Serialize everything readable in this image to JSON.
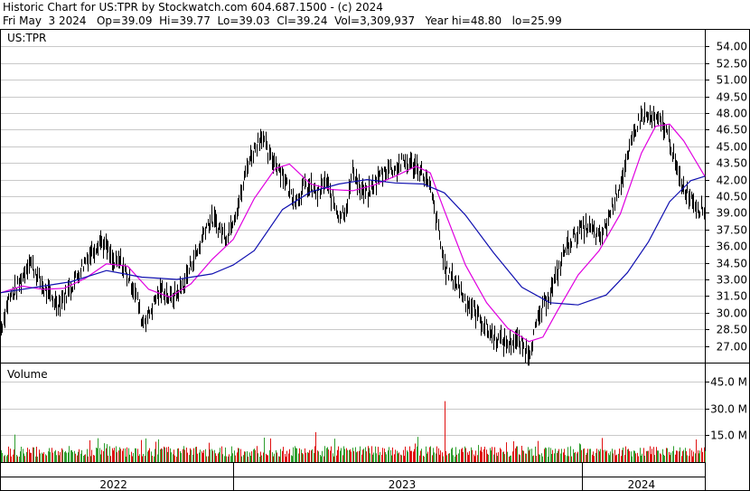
{
  "header": {
    "line1": "Historic Chart for US:TPR by Stockwatch.com 604.687.1500 - (c) 2024",
    "line2": "Fri May  3 2024   Op=39.09  Hi=39.77  Lo=39.03  Cl=39.24  Vol=3,309,937   Year hi=48.80   lo=25.99"
  },
  "colors": {
    "price": "#000000",
    "ma_short": "#e000e0",
    "ma_long": "#1010b0",
    "vol_up": "#2e9e2e",
    "vol_down": "#e01010",
    "frame": "#000000"
  },
  "chart_data": [
    {
      "type": "line",
      "label": "US:TPR",
      "y_axis": {
        "min": 25.5,
        "max": 55.5,
        "ticks": [
          54.0,
          52.5,
          51.0,
          49.5,
          48.0,
          46.5,
          45.0,
          43.5,
          42.0,
          40.5,
          39.0,
          37.5,
          36.0,
          34.5,
          33.0,
          31.5,
          30.0,
          28.5,
          27.0
        ],
        "tick_labels": [
          "54.00",
          "52.50",
          "51.00",
          "49.50",
          "48.00",
          "46.50",
          "45.00",
          "43.50",
          "42.00",
          "40.50",
          "39.00",
          "37.50",
          "36.00",
          "34.50",
          "33.00",
          "31.50",
          "30.00",
          "28.50",
          "27.00"
        ]
      },
      "x_range": [
        0,
        100
      ],
      "price_points": [
        [
          0,
          28.6
        ],
        [
          1,
          31.2
        ],
        [
          2,
          32.0
        ],
        [
          3,
          33.2
        ],
        [
          4,
          34.8
        ],
        [
          5,
          33.5
        ],
        [
          6,
          32.2
        ],
        [
          7,
          31.4
        ],
        [
          8,
          30.8
        ],
        [
          9,
          31.5
        ],
        [
          10,
          32.4
        ],
        [
          11,
          33.6
        ],
        [
          12,
          34.8
        ],
        [
          13,
          35.6
        ],
        [
          14,
          36.6
        ],
        [
          15,
          35.8
        ],
        [
          16,
          34.3
        ],
        [
          17,
          34.6
        ],
        [
          18,
          33.2
        ],
        [
          19,
          32.0
        ],
        [
          20,
          29.2
        ],
        [
          21,
          29.8
        ],
        [
          22,
          31.4
        ],
        [
          23,
          32.1
        ],
        [
          24,
          31.2
        ],
        [
          25,
          31.8
        ],
        [
          26,
          32.6
        ],
        [
          27,
          34.5
        ],
        [
          28,
          35.6
        ],
        [
          29,
          37.8
        ],
        [
          30,
          38.4
        ],
        [
          31,
          37.6
        ],
        [
          32,
          36.9
        ],
        [
          33,
          38.6
        ],
        [
          34,
          40.4
        ],
        [
          35,
          43.5
        ],
        [
          36,
          44.8
        ],
        [
          37,
          46.2
        ],
        [
          38,
          44.0
        ],
        [
          39,
          43.6
        ],
        [
          40,
          42.5
        ],
        [
          41,
          40.8
        ],
        [
          42,
          40.2
        ],
        [
          43,
          41.4
        ],
        [
          44,
          41.2
        ],
        [
          45,
          40.6
        ],
        [
          46,
          41.9
        ],
        [
          47,
          40.3
        ],
        [
          48,
          38.8
        ],
        [
          49,
          39.4
        ],
        [
          50,
          43.0
        ],
        [
          51,
          41.0
        ],
        [
          52,
          40.6
        ],
        [
          53,
          41.6
        ],
        [
          54,
          42.5
        ],
        [
          55,
          43.1
        ],
        [
          56,
          42.9
        ],
        [
          57,
          43.6
        ],
        [
          58,
          43.4
        ],
        [
          59,
          43.2
        ],
        [
          60,
          42.4
        ],
        [
          61,
          41.0
        ],
        [
          62,
          37.8
        ],
        [
          63,
          34.0
        ],
        [
          64,
          33.2
        ],
        [
          65,
          32.4
        ],
        [
          66,
          31.0
        ],
        [
          67,
          30.4
        ],
        [
          68,
          29.4
        ],
        [
          69,
          28.5
        ],
        [
          70,
          27.8
        ],
        [
          71,
          27.5
        ],
        [
          72,
          27.2
        ],
        [
          73,
          27.6
        ],
        [
          74,
          27.0
        ],
        [
          75,
          26.4
        ],
        [
          76,
          28.8
        ],
        [
          77,
          30.5
        ],
        [
          78,
          31.9
        ],
        [
          79,
          33.5
        ],
        [
          80,
          35.6
        ],
        [
          81,
          36.6
        ],
        [
          82,
          37.3
        ],
        [
          83,
          37.7
        ],
        [
          84,
          37.4
        ],
        [
          85,
          36.6
        ],
        [
          86,
          38.0
        ],
        [
          87,
          40.0
        ],
        [
          88,
          41.8
        ],
        [
          89,
          43.8
        ],
        [
          90,
          46.5
        ],
        [
          91,
          47.8
        ],
        [
          92,
          47.6
        ],
        [
          93,
          47.3
        ],
        [
          94,
          47.0
        ],
        [
          95,
          45.5
        ],
        [
          96,
          42.6
        ],
        [
          97,
          41.2
        ],
        [
          98,
          40.5
        ],
        [
          99,
          39.5
        ],
        [
          100,
          39.2
        ]
      ],
      "ma_short_points": [
        [
          0,
          31.8
        ],
        [
          3,
          32.4
        ],
        [
          6,
          32.1
        ],
        [
          9,
          32.2
        ],
        [
          12,
          33.1
        ],
        [
          15,
          34.4
        ],
        [
          18,
          34.2
        ],
        [
          21,
          32.1
        ],
        [
          24,
          31.4
        ],
        [
          27,
          32.6
        ],
        [
          30,
          34.8
        ],
        [
          33,
          36.6
        ],
        [
          36,
          40.3
        ],
        [
          39,
          43.0
        ],
        [
          41,
          43.4
        ],
        [
          44,
          41.6
        ],
        [
          47,
          41.1
        ],
        [
          50,
          41.0
        ],
        [
          53,
          41.5
        ],
        [
          56,
          42.3
        ],
        [
          59,
          43.2
        ],
        [
          61,
          42.6
        ],
        [
          63,
          39.2
        ],
        [
          66,
          34.3
        ],
        [
          69,
          30.9
        ],
        [
          72,
          28.6
        ],
        [
          75,
          27.4
        ],
        [
          77,
          27.8
        ],
        [
          79,
          30.1
        ],
        [
          82,
          33.4
        ],
        [
          85,
          35.6
        ],
        [
          88,
          38.9
        ],
        [
          91,
          44.4
        ],
        [
          93,
          46.8
        ],
        [
          95,
          47.0
        ],
        [
          97,
          45.5
        ],
        [
          100,
          42.3
        ]
      ],
      "ma_long_points": [
        [
          0,
          31.8
        ],
        [
          5,
          32.3
        ],
        [
          10,
          32.8
        ],
        [
          15,
          33.8
        ],
        [
          20,
          33.2
        ],
        [
          25,
          33.0
        ],
        [
          30,
          33.5
        ],
        [
          33,
          34.3
        ],
        [
          36,
          35.6
        ],
        [
          40,
          39.3
        ],
        [
          44,
          40.9
        ],
        [
          48,
          41.6
        ],
        [
          52,
          42.0
        ],
        [
          56,
          41.7
        ],
        [
          60,
          41.6
        ],
        [
          63,
          40.8
        ],
        [
          66,
          38.8
        ],
        [
          70,
          35.4
        ],
        [
          74,
          32.3
        ],
        [
          78,
          30.9
        ],
        [
          82,
          30.7
        ],
        [
          86,
          31.6
        ],
        [
          89,
          33.6
        ],
        [
          92,
          36.4
        ],
        [
          95,
          40.0
        ],
        [
          98,
          41.9
        ],
        [
          100,
          42.3
        ]
      ]
    },
    {
      "type": "bar",
      "label": "Volume",
      "unit": "M",
      "y_axis": {
        "min": 0,
        "max": 55,
        "ticks": [
          45.0,
          30.0,
          15.0
        ],
        "tick_labels": [
          "45.0 M",
          "30.0 M",
          "15.0 M"
        ]
      },
      "spike": {
        "x": 63,
        "value": 34.0
      },
      "typical_value_range": [
        3,
        9
      ]
    },
    {
      "type": "axis",
      "x_labels": [
        "2022",
        "2023",
        "2024"
      ],
      "x_label_positions_fraction": [
        0.16,
        0.57,
        0.91
      ],
      "year_dividers_fraction": [
        0.33,
        0.826
      ]
    }
  ]
}
